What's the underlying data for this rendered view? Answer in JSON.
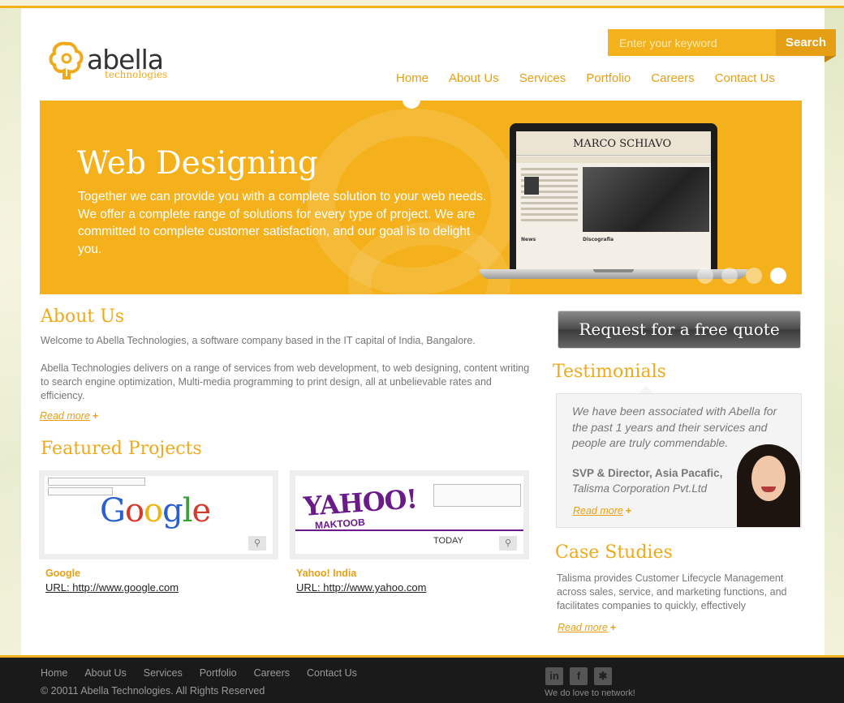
{
  "brand": {
    "name": "abella",
    "subtitle": "technologies",
    "accent": "#f3b21b"
  },
  "search": {
    "placeholder": "Enter your keyword",
    "button_label": "Search"
  },
  "nav": {
    "items": [
      "Home",
      "About Us",
      "Services",
      "Portfolio",
      "Careers",
      "Contact Us"
    ]
  },
  "banner": {
    "title": "Web Designing",
    "text": "Together we can provide you with a complete solution to your web needs. We offer a complete range of solutions for every type of project. We are committed to complete customer satisfaction, and our goal is to delight you.",
    "screen_title": "MARCO SCHIAVO",
    "screen_news": "News",
    "screen_discografia": "Discografia",
    "slides": 4,
    "active_slide": 4
  },
  "about": {
    "heading": "About Us",
    "intro": "Welcome to Abella Technologies, a software company based in the IT capital of India, Bangalore.",
    "body": "Abella Technologies delivers on a range of services from web development, to web designing, content writing to search engine optimization, Multi-media programming to print design, all at unbelievable rates and efficiency.",
    "read_more": "Read more"
  },
  "featured": {
    "heading": "Featured Projects",
    "projects": [
      {
        "name": "Google",
        "url": "URL: http://www.google.com"
      },
      {
        "name": "Yahoo! India",
        "url": "URL: http://www.yahoo.com"
      }
    ],
    "google_word": "Google",
    "yahoo_word": "YAHOO!",
    "yahoo_sub": "MAKTOOB",
    "yahoo_today": "TODAY"
  },
  "quote_button": "Request for a free quote",
  "testimonials": {
    "heading": "Testimonials",
    "quote": "We have been associated with Abella for the past 1 years and their services and people are truly commendable.",
    "role": "SVP & Director, Asia Pacafic,",
    "company": "Talisma Corporation Pvt.Ltd",
    "read_more": "Read more"
  },
  "case_studies": {
    "heading": "Case Studies",
    "text": "Talisma provides Customer Lifecycle Management across sales, service, and marketing functions, and facilitates companies to quickly, effectively",
    "read_more": "Read more"
  },
  "footer": {
    "nav": [
      "Home",
      "About Us",
      "Services",
      "Portfolio",
      "Careers",
      "Contact Us"
    ],
    "copyright": "© 20011 Abella Technologies. All Rights Reserved",
    "social_icons": [
      "linkedin-icon",
      "facebook-icon",
      "myspace-icon"
    ],
    "network_text": "We do love to network!"
  }
}
